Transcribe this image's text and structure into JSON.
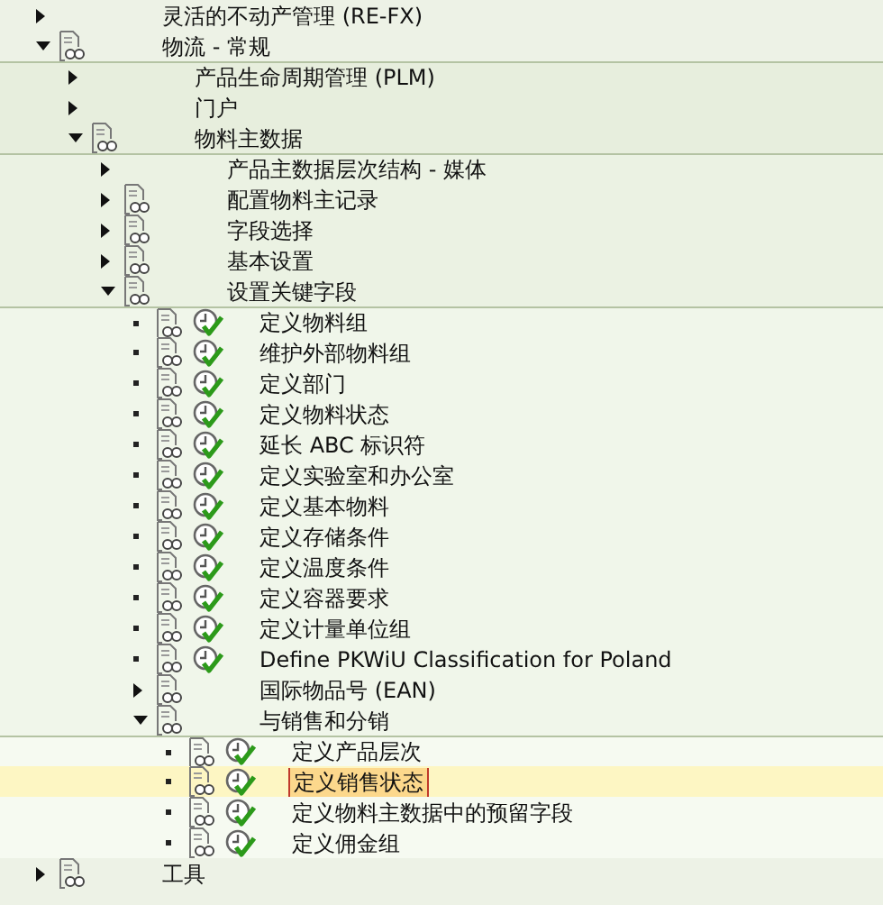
{
  "tree": [
    {
      "kind": "folder",
      "label": "灵活的不动产管理 (RE-FX)",
      "expanded": false,
      "doc": false,
      "selected": false
    },
    {
      "kind": "folder",
      "label": "物流 - 常规",
      "expanded": true,
      "doc": true,
      "selected": false,
      "children": [
        {
          "kind": "folder",
          "label": "产品生命周期管理 (PLM)",
          "expanded": false,
          "doc": false,
          "selected": false
        },
        {
          "kind": "folder",
          "label": "门户",
          "expanded": false,
          "doc": false,
          "selected": false
        },
        {
          "kind": "folder",
          "label": "物料主数据",
          "expanded": true,
          "doc": true,
          "selected": false,
          "children": [
            {
              "kind": "folder",
              "label": "产品主数据层次结构 - 媒体",
              "expanded": false,
              "doc": false,
              "selected": false
            },
            {
              "kind": "folder",
              "label": "配置物料主记录",
              "expanded": false,
              "doc": true,
              "selected": false
            },
            {
              "kind": "folder",
              "label": "字段选择",
              "expanded": false,
              "doc": true,
              "selected": false
            },
            {
              "kind": "folder",
              "label": "基本设置",
              "expanded": false,
              "doc": true,
              "selected": false
            },
            {
              "kind": "folder",
              "label": "设置关键字段",
              "expanded": true,
              "doc": true,
              "selected": false,
              "children": [
                {
                  "kind": "activity",
                  "label": "定义物料组",
                  "doc": true,
                  "selected": false
                },
                {
                  "kind": "activity",
                  "label": "维护外部物料组",
                  "doc": true,
                  "selected": false
                },
                {
                  "kind": "activity",
                  "label": "定义部门",
                  "doc": true,
                  "selected": false
                },
                {
                  "kind": "activity",
                  "label": "定义物料状态",
                  "doc": true,
                  "selected": false
                },
                {
                  "kind": "activity",
                  "label": "延长 ABC 标识符",
                  "doc": true,
                  "selected": false
                },
                {
                  "kind": "activity",
                  "label": "定义实验室和办公室",
                  "doc": true,
                  "selected": false
                },
                {
                  "kind": "activity",
                  "label": "定义基本物料",
                  "doc": true,
                  "selected": false
                },
                {
                  "kind": "activity",
                  "label": "定义存储条件",
                  "doc": true,
                  "selected": false
                },
                {
                  "kind": "activity",
                  "label": "定义温度条件",
                  "doc": true,
                  "selected": false
                },
                {
                  "kind": "activity",
                  "label": "定义容器要求",
                  "doc": true,
                  "selected": false
                },
                {
                  "kind": "activity",
                  "label": "定义计量单位组",
                  "doc": true,
                  "selected": false
                },
                {
                  "kind": "activity",
                  "label": "Define PKWiU Classification for Poland",
                  "doc": true,
                  "selected": false
                },
                {
                  "kind": "folder",
                  "label": "国际物品号 (EAN)",
                  "expanded": false,
                  "doc": true,
                  "selected": false
                },
                {
                  "kind": "folder",
                  "label": "与销售和分销",
                  "expanded": true,
                  "doc": true,
                  "selected": false,
                  "children": [
                    {
                      "kind": "activity",
                      "label": "定义产品层次",
                      "doc": true,
                      "selected": false
                    },
                    {
                      "kind": "activity",
                      "label": "定义销售状态",
                      "doc": true,
                      "selected": true
                    },
                    {
                      "kind": "activity",
                      "label": "定义物料主数据中的预留字段",
                      "doc": true,
                      "selected": false
                    },
                    {
                      "kind": "activity",
                      "label": "定义佣金组",
                      "doc": true,
                      "selected": false
                    }
                  ]
                }
              ]
            }
          ]
        }
      ]
    },
    {
      "kind": "folder",
      "label": "工具",
      "expanded": false,
      "doc": true,
      "selected": false
    }
  ]
}
